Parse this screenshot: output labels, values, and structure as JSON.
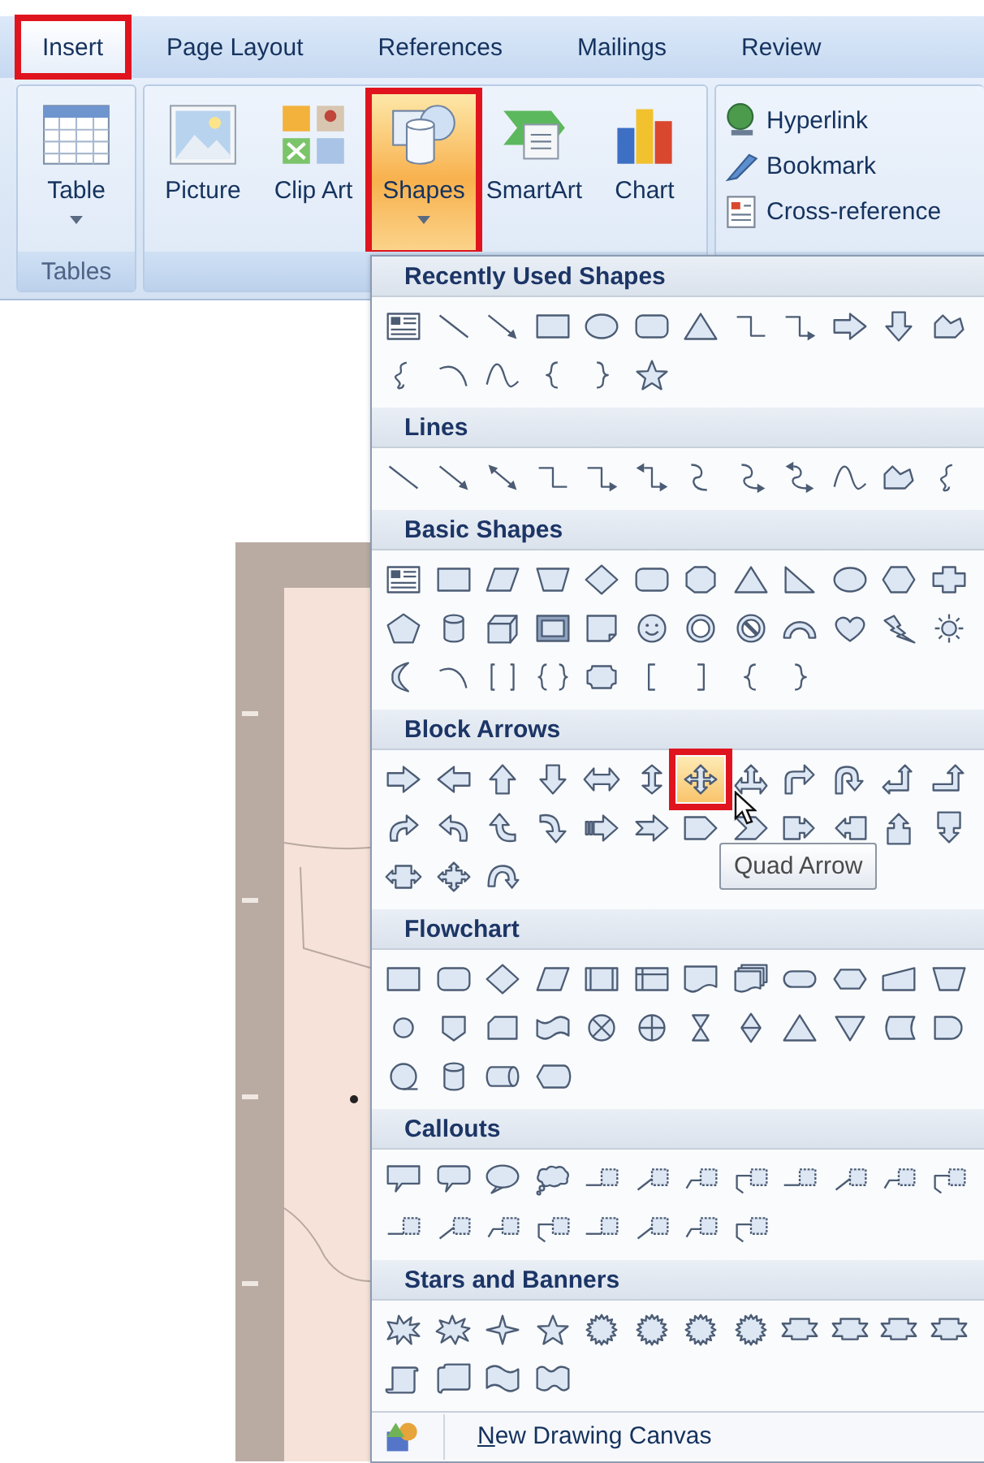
{
  "tabs": [
    {
      "label": "Insert",
      "selected": true,
      "annotated": true
    },
    {
      "label": "Page Layout",
      "selected": false,
      "annotated": false
    },
    {
      "label": "References",
      "selected": false,
      "annotated": false
    },
    {
      "label": "Mailings",
      "selected": false,
      "annotated": false
    },
    {
      "label": "Review",
      "selected": false,
      "annotated": false
    }
  ],
  "ribbon": {
    "groups": [
      {
        "label": "Tables",
        "buttons": [
          {
            "label": "Table",
            "dropdown": true,
            "pressed": false,
            "annotated": false
          }
        ]
      },
      {
        "buttons": [
          {
            "label": "Picture",
            "dropdown": false,
            "pressed": false,
            "annotated": false
          },
          {
            "label": "Clip Art",
            "dropdown": false,
            "pressed": false,
            "annotated": false
          },
          {
            "label": "Shapes",
            "dropdown": true,
            "pressed": true,
            "annotated": true
          },
          {
            "label": "SmartArt",
            "dropdown": false,
            "pressed": false,
            "annotated": false
          },
          {
            "label": "Chart",
            "dropdown": false,
            "pressed": false,
            "annotated": false
          }
        ]
      },
      {
        "links": [
          {
            "label": "Hyperlink"
          },
          {
            "label": "Bookmark"
          },
          {
            "label": "Cross-reference"
          }
        ]
      }
    ]
  },
  "gallery": {
    "sections": [
      {
        "title": "Recently Used Shapes",
        "shapes": [
          {
            "selected": false,
            "annotated": false
          },
          {
            "selected": false,
            "annotated": false
          },
          {
            "selected": false,
            "annotated": false
          },
          {
            "selected": false,
            "annotated": false
          },
          {
            "selected": false,
            "annotated": false
          },
          {
            "selected": false,
            "annotated": false
          },
          {
            "selected": false,
            "annotated": false
          },
          {
            "selected": false,
            "annotated": false
          },
          {
            "selected": false,
            "annotated": false
          },
          {
            "selected": false,
            "annotated": false
          },
          {
            "selected": false,
            "annotated": false
          },
          {
            "selected": false,
            "annotated": false
          },
          {
            "selected": false,
            "annotated": false
          },
          {
            "selected": false,
            "annotated": false
          },
          {
            "selected": false,
            "annotated": false
          },
          {
            "selected": false,
            "annotated": false
          },
          {
            "selected": false,
            "annotated": false
          },
          {
            "selected": false,
            "annotated": false
          }
        ]
      },
      {
        "title": "Lines",
        "shapes": [
          {
            "selected": false,
            "annotated": false
          },
          {
            "selected": false,
            "annotated": false
          },
          {
            "selected": false,
            "annotated": false
          },
          {
            "selected": false,
            "annotated": false
          },
          {
            "selected": false,
            "annotated": false
          },
          {
            "selected": false,
            "annotated": false
          },
          {
            "selected": false,
            "annotated": false
          },
          {
            "selected": false,
            "annotated": false
          },
          {
            "selected": false,
            "annotated": false
          },
          {
            "selected": false,
            "annotated": false
          },
          {
            "selected": false,
            "annotated": false
          },
          {
            "selected": false,
            "annotated": false
          }
        ]
      },
      {
        "title": "Basic Shapes",
        "shapes": [
          {
            "selected": false,
            "annotated": false
          },
          {
            "selected": false,
            "annotated": false
          },
          {
            "selected": false,
            "annotated": false
          },
          {
            "selected": false,
            "annotated": false
          },
          {
            "selected": false,
            "annotated": false
          },
          {
            "selected": false,
            "annotated": false
          },
          {
            "selected": false,
            "annotated": false
          },
          {
            "selected": false,
            "annotated": false
          },
          {
            "selected": false,
            "annotated": false
          },
          {
            "selected": false,
            "annotated": false
          },
          {
            "selected": false,
            "annotated": false
          },
          {
            "selected": false,
            "annotated": false
          },
          {
            "selected": false,
            "annotated": false
          },
          {
            "selected": false,
            "annotated": false
          },
          {
            "selected": false,
            "annotated": false
          },
          {
            "selected": false,
            "annotated": false
          },
          {
            "selected": false,
            "annotated": false
          },
          {
            "selected": false,
            "annotated": false
          },
          {
            "selected": false,
            "annotated": false
          },
          {
            "selected": false,
            "annotated": false
          },
          {
            "selected": false,
            "annotated": false
          },
          {
            "selected": false,
            "annotated": false
          },
          {
            "selected": false,
            "annotated": false
          },
          {
            "selected": false,
            "annotated": false
          },
          {
            "selected": false,
            "annotated": false
          },
          {
            "selected": false,
            "annotated": false
          },
          {
            "selected": false,
            "annotated": false
          },
          {
            "selected": false,
            "annotated": false
          },
          {
            "selected": false,
            "annotated": false
          },
          {
            "selected": false,
            "annotated": false
          },
          {
            "selected": false,
            "annotated": false
          },
          {
            "selected": false,
            "annotated": false
          },
          {
            "selected": false,
            "annotated": false
          }
        ]
      },
      {
        "title": "Block Arrows",
        "shapes": [
          {
            "selected": false,
            "annotated": false
          },
          {
            "selected": false,
            "annotated": false
          },
          {
            "selected": false,
            "annotated": false
          },
          {
            "selected": false,
            "annotated": false
          },
          {
            "selected": false,
            "annotated": false
          },
          {
            "selected": false,
            "annotated": false
          },
          {
            "selected": true,
            "annotated": true
          },
          {
            "selected": false,
            "annotated": false
          },
          {
            "selected": false,
            "annotated": false
          },
          {
            "selected": false,
            "annotated": false
          },
          {
            "selected": false,
            "annotated": false
          },
          {
            "selected": false,
            "annotated": false
          },
          {
            "selected": false,
            "annotated": false
          },
          {
            "selected": false,
            "annotated": false
          },
          {
            "selected": false,
            "annotated": false
          },
          {
            "selected": false,
            "annotated": false
          },
          {
            "selected": false,
            "annotated": false
          },
          {
            "selected": false,
            "annotated": false
          },
          {
            "selected": false,
            "annotated": false
          },
          {
            "selected": false,
            "annotated": false
          },
          {
            "selected": false,
            "annotated": false
          },
          {
            "selected": false,
            "annotated": false
          },
          {
            "selected": false,
            "annotated": false
          },
          {
            "selected": false,
            "annotated": false
          },
          {
            "selected": false,
            "annotated": false
          },
          {
            "selected": false,
            "annotated": false
          },
          {
            "selected": false,
            "annotated": false
          }
        ]
      },
      {
        "title": "Flowchart",
        "shapes": [
          {
            "selected": false,
            "annotated": false
          },
          {
            "selected": false,
            "annotated": false
          },
          {
            "selected": false,
            "annotated": false
          },
          {
            "selected": false,
            "annotated": false
          },
          {
            "selected": false,
            "annotated": false
          },
          {
            "selected": false,
            "annotated": false
          },
          {
            "selected": false,
            "annotated": false
          },
          {
            "selected": false,
            "annotated": false
          },
          {
            "selected": false,
            "annotated": false
          },
          {
            "selected": false,
            "annotated": false
          },
          {
            "selected": false,
            "annotated": false
          },
          {
            "selected": false,
            "annotated": false
          },
          {
            "selected": false,
            "annotated": false
          },
          {
            "selected": false,
            "annotated": false
          },
          {
            "selected": false,
            "annotated": false
          },
          {
            "selected": false,
            "annotated": false
          },
          {
            "selected": false,
            "annotated": false
          },
          {
            "selected": false,
            "annotated": false
          },
          {
            "selected": false,
            "annotated": false
          },
          {
            "selected": false,
            "annotated": false
          },
          {
            "selected": false,
            "annotated": false
          },
          {
            "selected": false,
            "annotated": false
          },
          {
            "selected": false,
            "annotated": false
          },
          {
            "selected": false,
            "annotated": false
          },
          {
            "selected": false,
            "annotated": false
          },
          {
            "selected": false,
            "annotated": false
          },
          {
            "selected": false,
            "annotated": false
          },
          {
            "selected": false,
            "annotated": false
          }
        ]
      },
      {
        "title": "Callouts",
        "shapes": [
          {
            "selected": false,
            "annotated": false
          },
          {
            "selected": false,
            "annotated": false
          },
          {
            "selected": false,
            "annotated": false
          },
          {
            "selected": false,
            "annotated": false
          },
          {
            "selected": false,
            "annotated": false
          },
          {
            "selected": false,
            "annotated": false
          },
          {
            "selected": false,
            "annotated": false
          },
          {
            "selected": false,
            "annotated": false
          },
          {
            "selected": false,
            "annotated": false
          },
          {
            "selected": false,
            "annotated": false
          },
          {
            "selected": false,
            "annotated": false
          },
          {
            "selected": false,
            "annotated": false
          },
          {
            "selected": false,
            "annotated": false
          },
          {
            "selected": false,
            "annotated": false
          },
          {
            "selected": false,
            "annotated": false
          },
          {
            "selected": false,
            "annotated": false
          },
          {
            "selected": false,
            "annotated": false
          },
          {
            "selected": false,
            "annotated": false
          },
          {
            "selected": false,
            "annotated": false
          },
          {
            "selected": false,
            "annotated": false
          }
        ]
      },
      {
        "title": "Stars and Banners",
        "shapes": [
          {
            "selected": false,
            "annotated": false
          },
          {
            "selected": false,
            "annotated": false
          },
          {
            "selected": false,
            "annotated": false
          },
          {
            "selected": false,
            "annotated": false
          },
          {
            "selected": false,
            "annotated": false
          },
          {
            "selected": false,
            "annotated": false
          },
          {
            "selected": false,
            "annotated": false
          },
          {
            "selected": false,
            "annotated": false
          },
          {
            "selected": false,
            "annotated": false
          },
          {
            "selected": false,
            "annotated": false
          },
          {
            "selected": false,
            "annotated": false
          },
          {
            "selected": false,
            "annotated": false
          },
          {
            "selected": false,
            "annotated": false
          },
          {
            "selected": false,
            "annotated": false
          },
          {
            "selected": false,
            "annotated": false
          },
          {
            "selected": false,
            "annotated": false
          }
        ]
      }
    ],
    "tooltip": "Quad Arrow",
    "footer_item": "New Drawing Canvas"
  }
}
